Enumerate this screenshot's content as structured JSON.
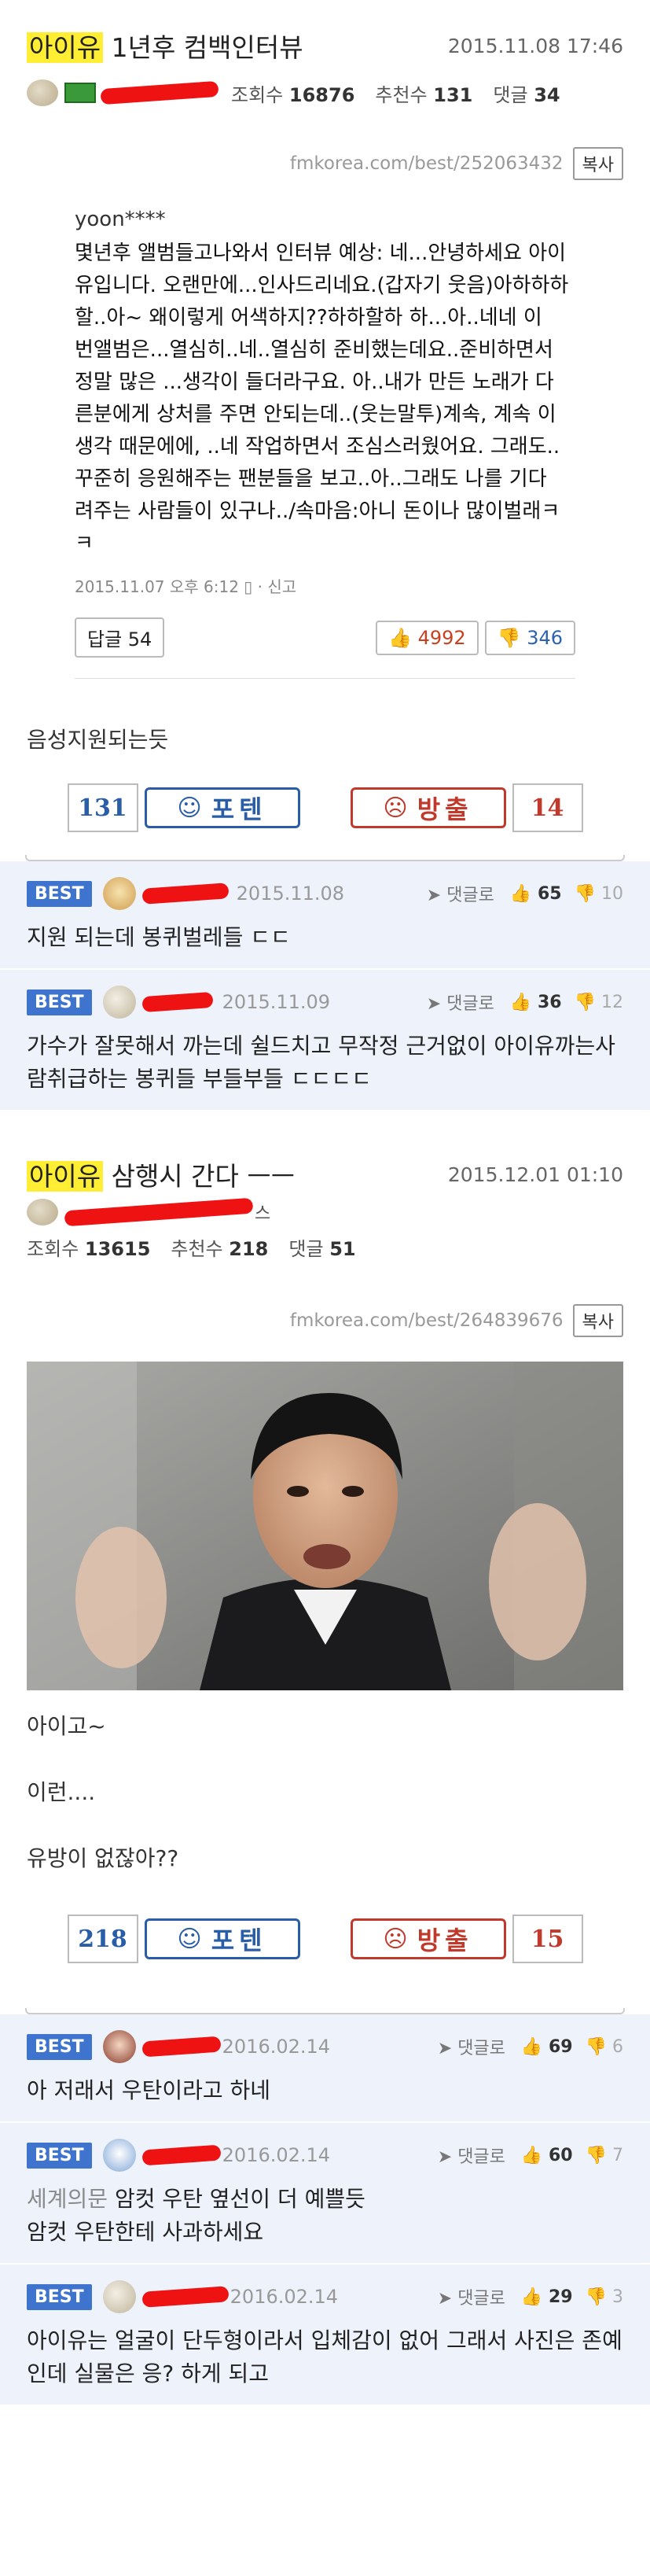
{
  "post1": {
    "title_tag": "아이유",
    "title_rest": " 1년후 컴백인터뷰",
    "datetime": "2015.11.08 17:46",
    "views_label": "조회수",
    "views": "16876",
    "recommend_label": "추천수",
    "recommend": "131",
    "comments_label": "댓글",
    "comments": "34",
    "source_url": "fmkorea.com/best/252063432",
    "copy_label": "복사",
    "quote": {
      "user": "yoon****",
      "lines": [
        "몇년후 앨범들고나와서 인터뷰 예상: 네...안녕하세요 아이",
        "유입니다. 오랜만에...인사드리네요.(갑자기 웃음)아하하하",
        "할..아~ 왜이렇게 어색하지??하하할하 하...아..네네 이",
        "번앨범은...열심히..네..열심히 준비했는데요..준비하면서",
        "정말 많은 ...생각이 들더라구요. 아..내가 만든 노래가 다",
        "른분에게 상처를 주면 안되는데..(웃는말투)계속, 계속 이",
        "생각 때문에에, ..네 작업하면서 조심스러웠어요. 그래도..",
        "꾸준히 응원해주는 팬분들을 보고..아..그래도 나를 기다",
        "려주는 사람들이 있구나../속마음:아니 돈이나 많이벌래ㅋ",
        "ㅋ"
      ],
      "footer": "2015.11.07 오후 6:12 ▯ · 신고",
      "reply_label": "답글 54",
      "up": "4992",
      "down": "346"
    },
    "body": [
      "음성지원되는듯"
    ],
    "vote": {
      "up_count": "131",
      "up_label": "포텐",
      "down_label": "방출",
      "down_count": "14"
    },
    "best_comments": [
      {
        "badge": "BEST",
        "date": "2015.11.08",
        "reply_label": "댓글로",
        "up": "65",
        "down": "10",
        "text": "지원 되는데 봉퀴벌레들 ㄷㄷ"
      },
      {
        "badge": "BEST",
        "date": "2015.11.09",
        "reply_label": "댓글로",
        "up": "36",
        "down": "12",
        "text": "가수가 잘못해서 까는데 쉴드치고 무작정 근거없이 아이유까는사람취급하는 봉퀴들 부들부들 ㄷㄷㄷㄷ"
      }
    ]
  },
  "post2": {
    "title_tag": "아이유",
    "title_rest": " 삼행시 간다 ㅡㅡ",
    "datetime": "2015.12.01 01:10",
    "author_suffix": "스",
    "views_label": "조회수",
    "views": "13615",
    "recommend_label": "추천수",
    "recommend": "218",
    "comments_label": "댓글",
    "comments": "51",
    "source_url": "fmkorea.com/best/264839676",
    "copy_label": "복사",
    "body": [
      "아이고~",
      "이런....",
      "유방이 없잖아??"
    ],
    "vote": {
      "up_count": "218",
      "up_label": "포텐",
      "down_label": "방출",
      "down_count": "15"
    },
    "best_comments": [
      {
        "badge": "BEST",
        "date": "2016.02.14",
        "reply_label": "댓글로",
        "up": "69",
        "down": "6",
        "text": "아 저래서 우탄이라고 하네"
      },
      {
        "badge": "BEST",
        "date": "2016.02.14",
        "reply_label": "댓글로",
        "up": "60",
        "down": "7",
        "ref": "세계의문",
        "text": " 암컷 우탄 옆선이 더 예쁠듯\n암컷 우탄한테 사과하세요"
      },
      {
        "badge": "BEST",
        "date": "2016.02.14",
        "reply_label": "댓글로",
        "up": "29",
        "down": "3",
        "text": "아이유는 얼굴이 단두형이라서 입체감이 없어 그래서 사진은 존예인데 실물은 응? 하게 되고"
      }
    ]
  },
  "colors": {
    "highlight": "#ffee34",
    "best_badge": "#3f74ce",
    "up": "#2a5da8",
    "down": "#c0392b",
    "redaction": "#ee1212"
  },
  "icons": [
    "thumb-up-icon",
    "thumb-down-icon",
    "reply-arrow-icon",
    "face-icon"
  ]
}
